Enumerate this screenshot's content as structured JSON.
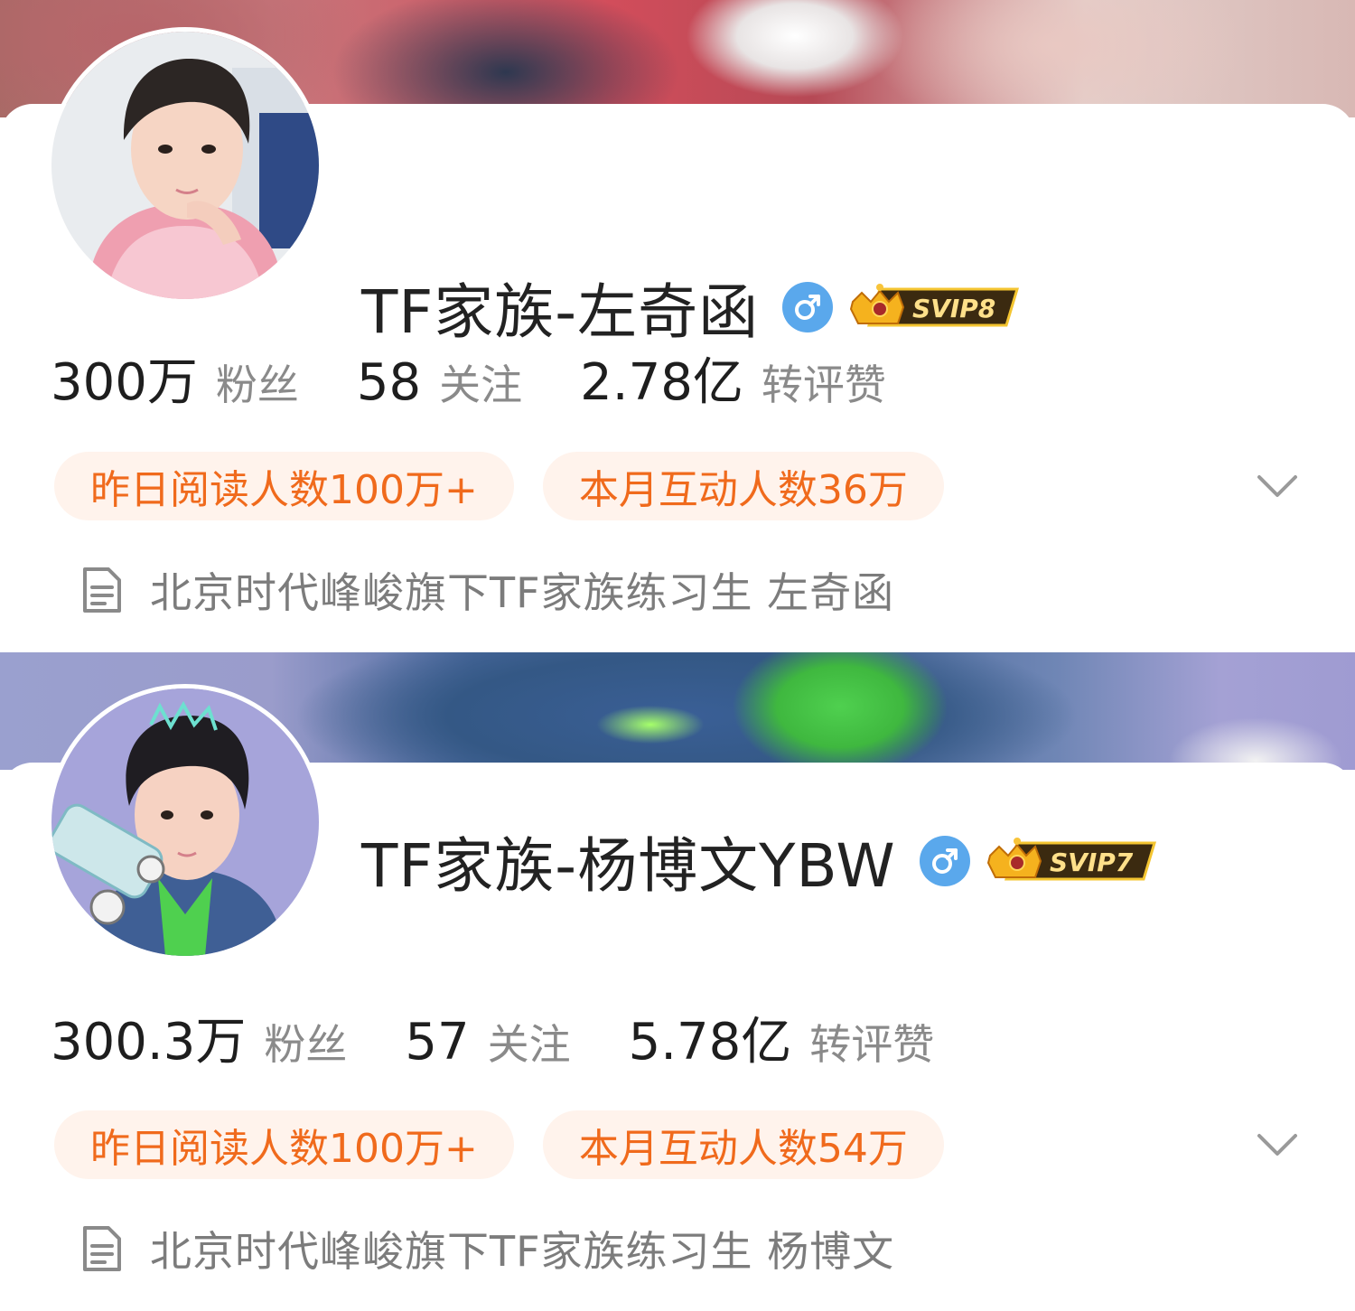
{
  "profiles": [
    {
      "name": "TF家族-左奇函",
      "vip": "SVIP8",
      "gender_icon": "male-icon",
      "stats": [
        {
          "value": "300万",
          "label": "粉丝"
        },
        {
          "value": "58",
          "label": "关注"
        },
        {
          "value": "2.78亿",
          "label": "转评赞"
        }
      ],
      "chips": [
        "昨日阅读人数100万+",
        "本月互动人数36万"
      ],
      "description": "北京时代峰峻旗下TF家族练习生  左奇函",
      "colors": {
        "accent": "#f06a1c",
        "chip_bg": "#fff3ec",
        "gender": "#5aa8ec"
      }
    },
    {
      "name": "TF家族-杨博文YBW",
      "vip": "SVIP7",
      "gender_icon": "male-icon",
      "stats": [
        {
          "value": "300.3万",
          "label": "粉丝"
        },
        {
          "value": "57",
          "label": "关注"
        },
        {
          "value": "5.78亿",
          "label": "转评赞"
        }
      ],
      "chips": [
        "昨日阅读人数100万+",
        "本月互动人数54万"
      ],
      "description": "北京时代峰峻旗下TF家族练习生  杨博文",
      "colors": {
        "accent": "#f06a1c",
        "chip_bg": "#fff3ec",
        "gender": "#5aa8ec"
      }
    }
  ]
}
